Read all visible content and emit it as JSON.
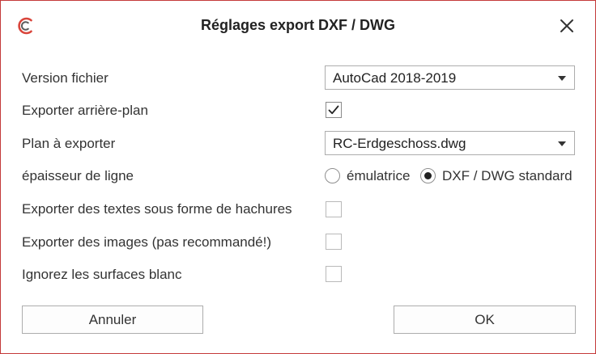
{
  "dialog": {
    "title": "Réglages export DXF / DWG"
  },
  "fields": {
    "version": {
      "label": "Version fichier",
      "value": "AutoCad 2018-2019"
    },
    "background": {
      "label": "Exporter arrière-plan",
      "checked": true
    },
    "plan": {
      "label": "Plan à exporter",
      "value": "RC-Erdgeschoss.dwg"
    },
    "linewidth": {
      "label": "épaisseur de ligne",
      "option1": "émulatrice",
      "option2": "DXF / DWG standard",
      "selected": "DXF / DWG standard"
    },
    "texts_hatch": {
      "label": "Exporter des textes sous forme de hachures",
      "checked": false
    },
    "images": {
      "label": "Exporter des images (pas recommandé!)",
      "checked": false
    },
    "white_surfaces": {
      "label": "Ignorez les surfaces blanc",
      "checked": false
    }
  },
  "buttons": {
    "cancel": "Annuler",
    "ok": "OK"
  },
  "colors": {
    "logo": "#d9453b",
    "border": "#c43a3a"
  }
}
